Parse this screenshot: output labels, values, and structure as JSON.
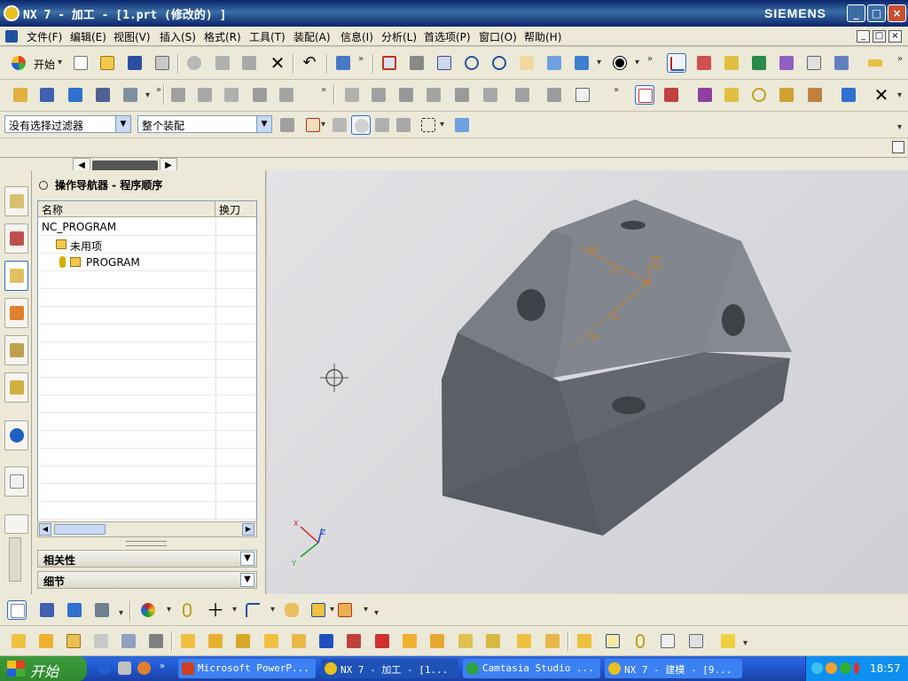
{
  "window": {
    "title": "NX 7 - 加工 - [1.prt (修改的) ]",
    "brand": "SIEMENS",
    "minimize": "_",
    "maximize": "□",
    "close": "×"
  },
  "menu": {
    "items": [
      "文件(F)",
      "编辑(E)",
      "视图(V)",
      "插入(S)",
      "格式(R)",
      "工具(T)",
      "装配(A)",
      "信息(I)",
      "分析(L)",
      "首选项(P)",
      "窗口(O)",
      "帮助(H)"
    ],
    "mdi": [
      "_",
      "□",
      "×"
    ]
  },
  "toolbar_standard": {
    "start_label": "开始"
  },
  "selection_bar": {
    "filter_value": "没有选择过滤器",
    "scope_value": "整个装配"
  },
  "navigator": {
    "title": "操作导航器 - 程序顺序",
    "columns": [
      "名称",
      "换刀"
    ],
    "rows": [
      "NC_PROGRAM",
      "未用项",
      "PROGRAM"
    ],
    "panels": [
      "相关性",
      "细节"
    ]
  },
  "viewport": {
    "wcs_labels": [
      "ZM",
      "YC",
      "ZC",
      "XC",
      "YC",
      "YM",
      "ZM"
    ],
    "triad": {
      "x": "X",
      "y": "Y",
      "z": "Z"
    }
  },
  "taskbar": {
    "start": "开始",
    "tasks": [
      "Microsoft PowerP...",
      "NX 7 - 加工 - [1...",
      "Camtasia Studio ...",
      "NX 7 - 建模 - [9..."
    ],
    "clock": "18:57"
  },
  "colors": {
    "title_bar": "#0a246a",
    "taskbar": "#245edc",
    "start_button": "#3c9a3c",
    "part": "#6b6f77",
    "wcs": "#d08020"
  },
  "icons": {
    "side_tabs": [
      "assembly-navigator-icon",
      "constraint-navigator-icon",
      "operation-navigator-icon",
      "machine-tool-icon",
      "part-navigator-icon",
      "tool-icon",
      "info-icon",
      "browser-icon"
    ]
  }
}
